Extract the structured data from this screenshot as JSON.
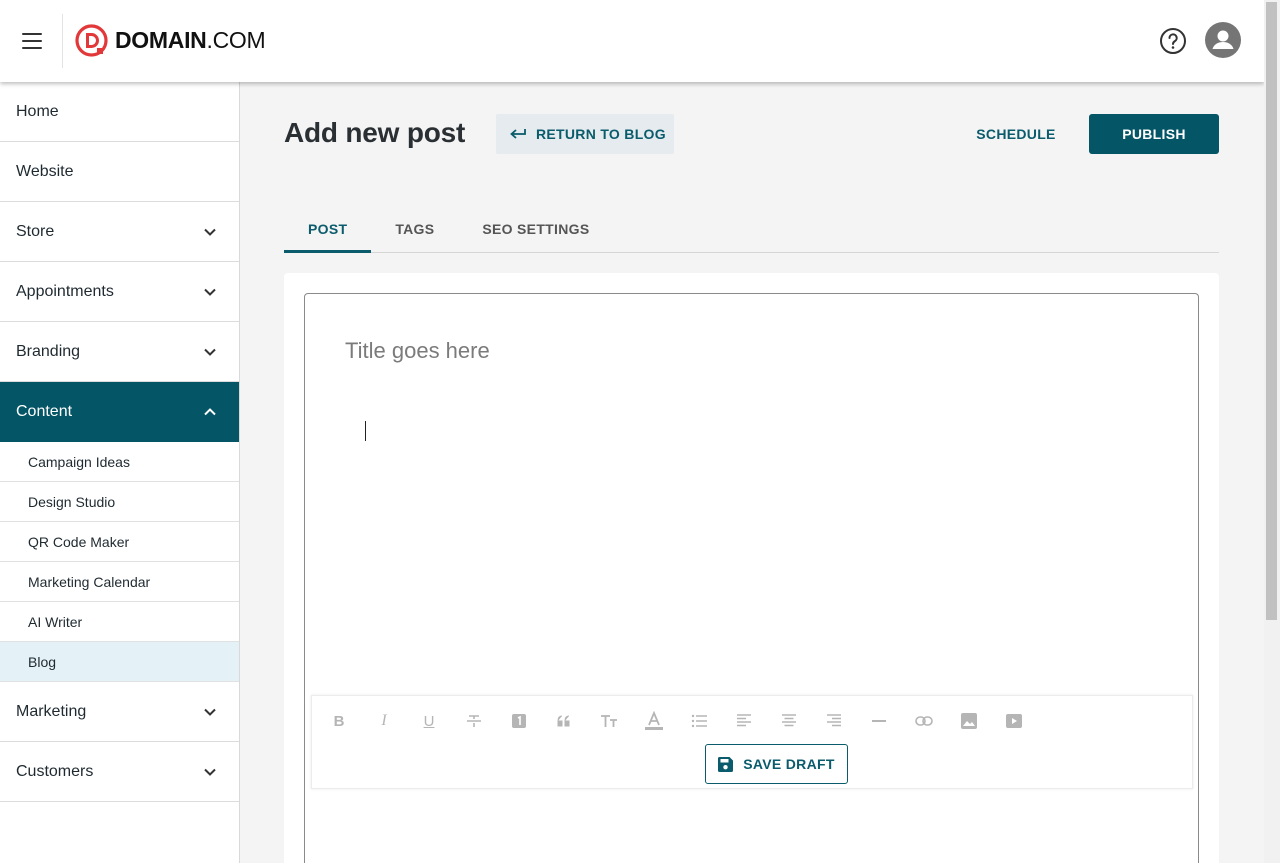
{
  "brand": {
    "name_bold": "DOMAIN",
    "name_light": ".COM",
    "logo_letter": "D"
  },
  "colors": {
    "primary": "#045565",
    "accent_red": "#e2383a",
    "selected_bg": "#e4f1f6"
  },
  "sidebar": {
    "items": [
      {
        "label": "Home",
        "expandable": false
      },
      {
        "label": "Website",
        "expandable": false
      },
      {
        "label": "Store",
        "expandable": true
      },
      {
        "label": "Appointments",
        "expandable": true
      },
      {
        "label": "Branding",
        "expandable": true
      },
      {
        "label": "Content",
        "expandable": true,
        "expanded": true,
        "active": true
      }
    ],
    "content_subitems": [
      "Campaign Ideas",
      "Design Studio",
      "QR Code Maker",
      "Marketing Calendar",
      "AI Writer",
      "Blog"
    ],
    "selected_subitem": "Blog",
    "items_after": [
      {
        "label": "Marketing",
        "expandable": true
      },
      {
        "label": "Customers",
        "expandable": true
      }
    ]
  },
  "main": {
    "title": "Add new post",
    "return_label": "RETURN TO BLOG",
    "schedule_label": "SCHEDULE",
    "publish_label": "PUBLISH",
    "tabs": [
      {
        "label": "POST",
        "active": true
      },
      {
        "label": "TAGS",
        "active": false
      },
      {
        "label": "SEO SETTINGS",
        "active": false
      }
    ],
    "editor": {
      "title_placeholder": "Title goes here",
      "title_value": "",
      "toolbar_icons": [
        "bold-icon",
        "italic-icon",
        "underline-icon",
        "strikethrough-icon",
        "heading-icon",
        "quote-icon",
        "font-size-icon",
        "text-color-icon",
        "list-icon",
        "align-left-icon",
        "align-center-icon",
        "align-right-icon",
        "horizontal-rule-icon",
        "link-icon",
        "image-icon",
        "video-icon"
      ],
      "toolbar_glyphs": {
        "bold": "B",
        "italic": "I",
        "underline": "U",
        "strike": "S"
      },
      "save_draft_label": "SAVE DRAFT"
    }
  }
}
